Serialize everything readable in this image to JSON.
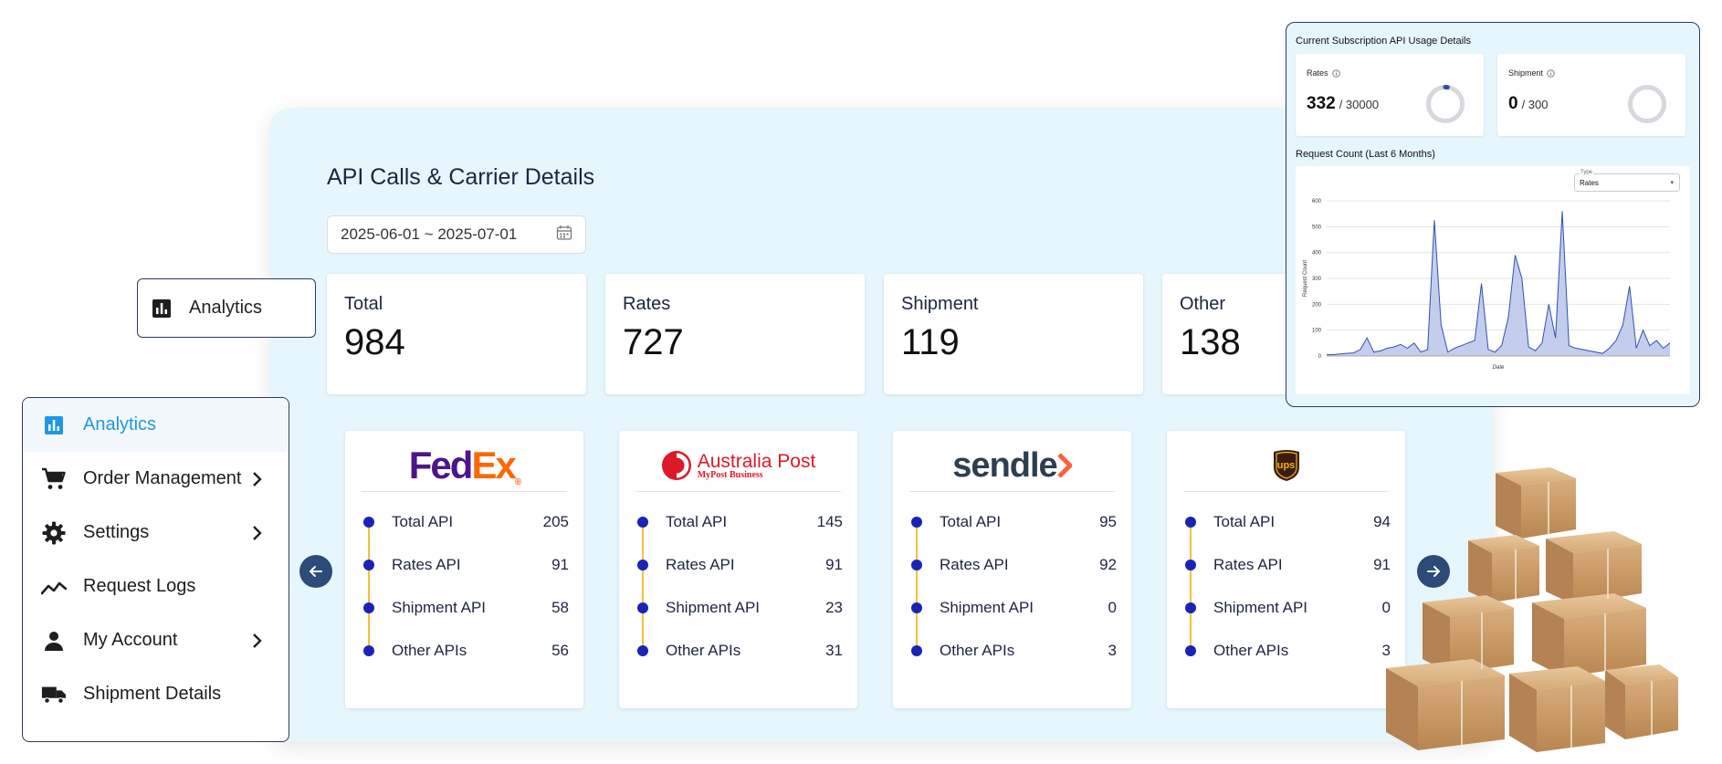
{
  "main": {
    "title": "API Calls & Carrier Details",
    "date_range": "2025-06-01 ~ 2025-07-01",
    "stats": [
      {
        "label": "Total",
        "value": "984"
      },
      {
        "label": "Rates",
        "value": "727"
      },
      {
        "label": "Shipment",
        "value": "119"
      },
      {
        "label": "Other",
        "value": "138"
      }
    ],
    "carriers": [
      {
        "name": "FedEx",
        "logo_text_1": "Fed",
        "logo_text_2": "Ex",
        "rows": [
          [
            "Total API",
            "205"
          ],
          [
            "Rates API",
            "91"
          ],
          [
            "Shipment API",
            "58"
          ],
          [
            "Other APIs",
            "56"
          ]
        ]
      },
      {
        "name": "Australia Post",
        "logo_text_1": "Australia Post",
        "logo_text_2": "MyPost Business",
        "rows": [
          [
            "Total API",
            "145"
          ],
          [
            "Rates API",
            "91"
          ],
          [
            "Shipment API",
            "23"
          ],
          [
            "Other APIs",
            "31"
          ]
        ]
      },
      {
        "name": "sendle",
        "logo_text_1": "sendle",
        "logo_text_2": "",
        "rows": [
          [
            "Total API",
            "95"
          ],
          [
            "Rates API",
            "92"
          ],
          [
            "Shipment API",
            "0"
          ],
          [
            "Other APIs",
            "3"
          ]
        ]
      },
      {
        "name": "UPS",
        "logo_text_1": "ups",
        "logo_text_2": "",
        "rows": [
          [
            "Total API",
            "94"
          ],
          [
            "Rates API",
            "91"
          ],
          [
            "Shipment API",
            "0"
          ],
          [
            "Other APIs",
            "3"
          ]
        ]
      }
    ]
  },
  "nav_pill": {
    "label": "Analytics"
  },
  "sidebar": {
    "items": [
      {
        "label": "Analytics",
        "icon": "bar-chart-icon",
        "active": true
      },
      {
        "label": "Order Management",
        "icon": "cart-icon",
        "chevron": true
      },
      {
        "label": "Settings",
        "icon": "gear-icon",
        "chevron": true
      },
      {
        "label": "Request Logs",
        "icon": "trend-line-icon"
      },
      {
        "label": "My Account",
        "icon": "person-icon",
        "chevron": true
      },
      {
        "label": "Shipment Details",
        "icon": "truck-icon"
      }
    ]
  },
  "usage": {
    "title": "Current Subscription API Usage Details",
    "rates": {
      "label": "Rates",
      "used": "332",
      "total": "/ 30000",
      "fraction": 0.011
    },
    "shipment": {
      "label": "Shipment",
      "used": "0",
      "total": "/ 300",
      "fraction": 0
    },
    "request_title": "Request Count (Last 6 Months)",
    "type_legend": "Type",
    "type_value": "Rates"
  },
  "colors": {
    "accent": "#2196e6",
    "dot": "#1a22b9",
    "timeline": "#f1c232",
    "panel": "#e6f6fd",
    "nav_button": "#2b4b78"
  },
  "chart_data": {
    "type": "area",
    "title": "",
    "xlabel": "Date",
    "ylabel": "Request Count",
    "ylim": [
      0,
      600
    ],
    "yticks": [
      0,
      100,
      200,
      300,
      400,
      500,
      600
    ],
    "grid": true,
    "series": [
      {
        "values": [
          5,
          5,
          8,
          10,
          12,
          25,
          70,
          15,
          20,
          30,
          35,
          45,
          30,
          50,
          15,
          25,
          525,
          120,
          15,
          30,
          40,
          50,
          60,
          280,
          25,
          15,
          40,
          150,
          390,
          300,
          35,
          20,
          50,
          200,
          70,
          560,
          40,
          30,
          25,
          20,
          15,
          10,
          30,
          60,
          120,
          270,
          30,
          100,
          40,
          60,
          30,
          50
        ]
      }
    ]
  }
}
